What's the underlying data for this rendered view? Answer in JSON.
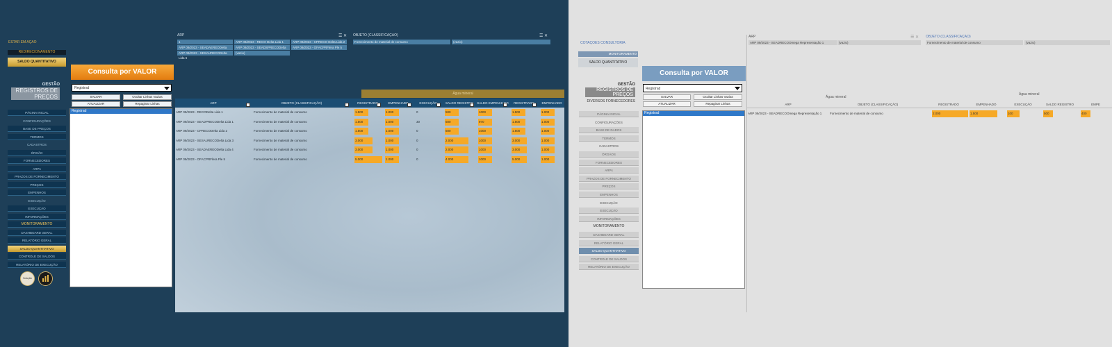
{
  "left": {
    "status": "ESTAR EM AÇÃO",
    "redirect_label": "REDIRECIONAMENTO",
    "saldo_top": "SALDO QUANTITATIVO",
    "consulta_title": "Consulta por VALOR",
    "logo": {
      "gestao": "GESTÃO",
      "registros": "REGISTROS DE PREÇOS"
    },
    "select_value": "Registrad",
    "buttons": {
      "salvar": "SALVAR",
      "ocultar": "Ocultar Linhas Vazias",
      "atualizar": "ATUALIZAR",
      "repaginar": "Repaginar Linhas"
    },
    "nav": [
      {
        "label": "PÁGINA INICIAL",
        "type": "item"
      },
      {
        "label": "CONFIGURAÇÕES",
        "type": "section"
      },
      {
        "label": "BASE DE PREÇOS",
        "type": "item"
      },
      {
        "label": "TERMOS",
        "type": "item"
      },
      {
        "label": "CADASTROS",
        "type": "section"
      },
      {
        "label": "ÓRGÃO",
        "type": "item"
      },
      {
        "label": "FORNECEDORES",
        "type": "item"
      },
      {
        "label": "ARPs",
        "type": "item"
      },
      {
        "label": "PRAZOS DE FORNECIMENTO",
        "type": "item"
      },
      {
        "label": "PREÇOS",
        "type": "item"
      },
      {
        "label": "EMPENHOS",
        "type": "item"
      },
      {
        "label": "EXECUÇÃO",
        "type": "section"
      },
      {
        "label": "EXECUÇÃO",
        "type": "item"
      },
      {
        "label": "INFORMAÇÕES",
        "type": "item"
      },
      {
        "label": "MONITORAMENTO",
        "type": "mon"
      },
      {
        "label": "DASHBOARD GERAL",
        "type": "item"
      },
      {
        "label": "RELATÓRIO GERAL",
        "type": "item"
      },
      {
        "label": "SALDO QUANTITATIVO",
        "type": "hl"
      },
      {
        "label": "CONTROLE DE SALDOS",
        "type": "item"
      },
      {
        "label": "RELATÓRIO DE EXECUÇÃO",
        "type": "item"
      }
    ],
    "icon_a_label": "Solução",
    "list_selected": "Registrad",
    "arp_label": "ARP",
    "arp_filters": [
      "1",
      "ARP 09/2023 - RECO Delta Lida 1",
      "ARP 09/2023 - CPRECO Delta Lida 2",
      "ARP 09/2023 - SEADAEREODelta Lida 4",
      "ARP 09/2023 - SEADSPRECODelta Lida 5",
      "ARP 09/2023 - OFACPRFlera Ple 5",
      "ARP 09/2023 - SESAURECODelta Lida 6",
      "(vazio)"
    ],
    "objeto_label": "OBJETO (CLASSIFICAÇÃO)",
    "objeto_filters": [
      "Fornecimento de material de consumo",
      "(vazio)"
    ],
    "agua_label": "Água mineral",
    "columns": [
      "ARP",
      "OBJETO (CLASSIFICAÇÃO)",
      "REGISTRADO",
      "EMPENHADO",
      "EXECUÇÃO",
      "SALDO REGISTRO",
      "SALDO EMPENHADO",
      "REGISTRADO",
      "EMPENHADO"
    ],
    "rows": [
      [
        "ARP 09/2023 - RECODelta Lida 1",
        "Fornecimento de material de consumo",
        "1.500",
        "1.000",
        "0",
        "500",
        "1000",
        "1.500",
        "1.000"
      ],
      [
        "ARP 09/2023 - SEADPRECODelta Lida 1",
        "Fornecimento de material de consumo",
        "1.500",
        "1.000",
        "30",
        "500",
        "970",
        "1.500",
        "1.000"
      ],
      [
        "ARP 09/2023 - CPRECODelta Lida 2",
        "Fornecimento de material de consumo",
        "1.500",
        "1.000",
        "0",
        "500",
        "1000",
        "1.500",
        "1.000"
      ],
      [
        "ARP 09/2023 - SESAURECODelta Lida 3",
        "Fornecimento de material de consumo",
        "3.000",
        "1.000",
        "0",
        "2.000",
        "1000",
        "3.000",
        "1.000"
      ],
      [
        "ARP 09/2023 - SEADAEREODelta Lida 4",
        "Fornecimento de material de consumo",
        "3.000",
        "1.000",
        "0",
        "2.000",
        "1000",
        "3.000",
        "1.000"
      ],
      [
        "ARP 09/2023 - OFACPRFlera Ple 5",
        "Fornecimento de material de consumo",
        "5.000",
        "1.000",
        "0",
        "4.000",
        "1000",
        "5.000",
        "1.000"
      ]
    ],
    "colors": {
      "accent_orange": "#f6a927",
      "header_blue": "#1b4d73",
      "gold": "#c79c2f"
    }
  },
  "right": {
    "status": "COTAÇÕES CONSULTORIA",
    "mon_top": "MONITORAMENTO",
    "saldo_top": "SALDO QUANTITATIVO",
    "consulta_title": "Consulta por VALOR",
    "logo": {
      "gestao": "GESTÃO",
      "registros": "REGISTROS DE PREÇOS",
      "fornecedores": "DIVERSOS FORNECEDORES"
    },
    "select_value": "Registrad",
    "buttons": {
      "salvar": "SALVAR",
      "ocultar": "Ocultar Linhas Vazias",
      "atualizar": "ATUALIZAR",
      "repaginar": "Repaginar Linhas"
    },
    "nav": [
      {
        "label": "PÁGINA INICIAL",
        "type": "item"
      },
      {
        "label": "CONFIGURAÇÕES",
        "type": "section"
      },
      {
        "label": "BASE DE DADOS",
        "type": "item"
      },
      {
        "label": "TERMOS",
        "type": "item"
      },
      {
        "label": "CADASTROS",
        "type": "section"
      },
      {
        "label": "ÓRGÃOS",
        "type": "item"
      },
      {
        "label": "FORNECEDORES",
        "type": "item"
      },
      {
        "label": "ARPs",
        "type": "item"
      },
      {
        "label": "PRAZOS DE FORNECIMENTO",
        "type": "item"
      },
      {
        "label": "PREÇOS",
        "type": "item"
      },
      {
        "label": "EMPENHOS",
        "type": "item"
      },
      {
        "label": "EXECUÇÃO",
        "type": "section"
      },
      {
        "label": "EXECUÇÃO",
        "type": "item"
      },
      {
        "label": "INFORMAÇÕES",
        "type": "item"
      },
      {
        "label": "MONITORAMENTO",
        "type": "mon"
      },
      {
        "label": "DASHBOARD GERAL",
        "type": "item"
      },
      {
        "label": "RELATÓRIO GERAL",
        "type": "item"
      },
      {
        "label": "SALDO QUANTITATIVO",
        "type": "hl"
      },
      {
        "label": "CONTROLE DE SALDOS",
        "type": "item"
      },
      {
        "label": "RELATÓRIO DE EXECUÇÃO",
        "type": "item"
      }
    ],
    "list_selected": "Registrad",
    "arp_label": "ARP",
    "arp_filters": [
      "ARP 09/2023 - SEADRECOOmega Representação 1",
      "(vazio)"
    ],
    "objeto_label": "OBJETO (CLASSIFICAÇÃO)",
    "objeto_filters": [
      "Fornecimento de material de consumo",
      "(vazio)"
    ],
    "agua_label_1": "Água mineral",
    "agua_label_2": "Água mineral",
    "columns": [
      "ARP",
      "OBJETO (CLASSIFICAÇÃO)",
      "REGISTRADO",
      "EMPENHADO",
      "EXECUÇÃO",
      "SALDO REGISTRO",
      "EMPE"
    ],
    "row": [
      "ARP 09/2023 - SEADRECOOmega Representação 1",
      "Fornecimento de material de consumo",
      "2.000",
      "1.500",
      "100",
      "500",
      "400"
    ],
    "colors": {
      "accent_orange": "#f6a927",
      "highlight_blue": "#6f8ead"
    }
  }
}
